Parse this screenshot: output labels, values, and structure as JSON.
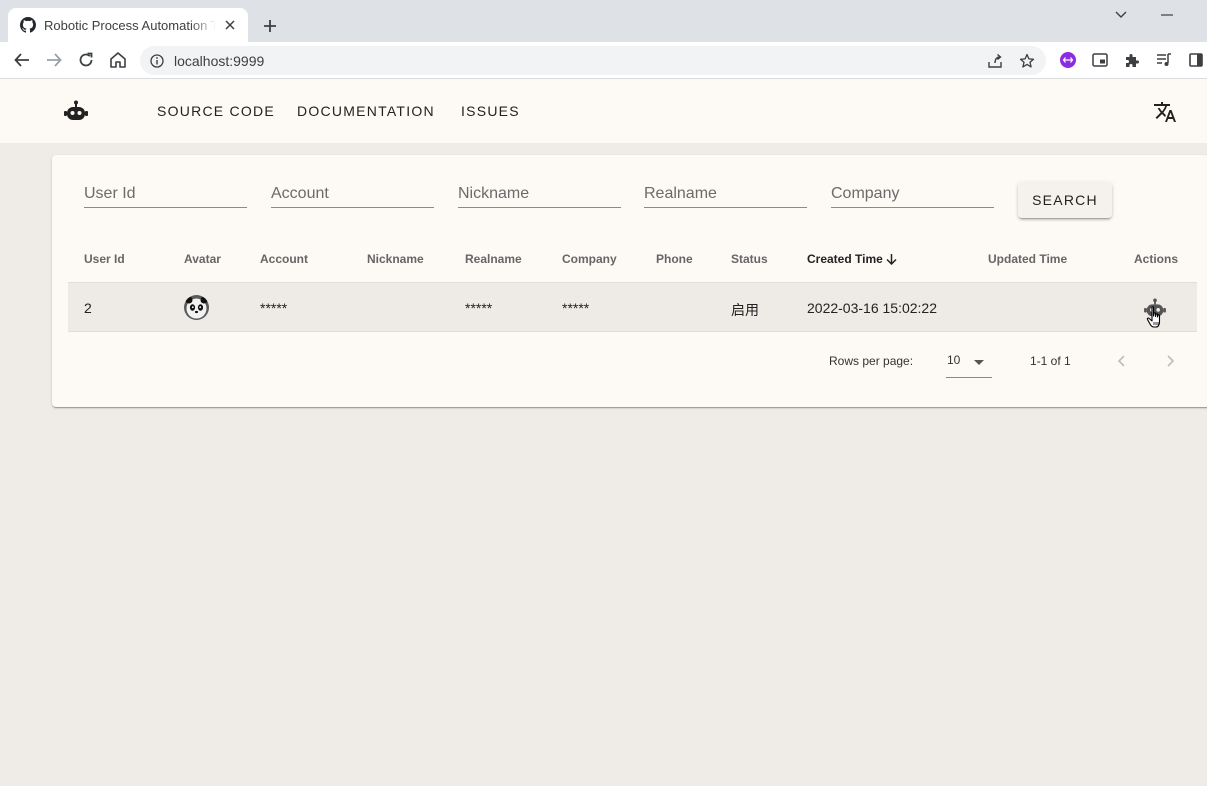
{
  "browser": {
    "tab_title": "Robotic Process Automation Tool",
    "url": "localhost:9999",
    "icons": [
      "github-icon",
      "close-icon",
      "plus-icon",
      "back-arrow-icon",
      "forward-arrow-icon",
      "reload-icon",
      "home-icon",
      "info-icon",
      "share-icon",
      "star-icon",
      "extension-icon",
      "picture-in-picture-icon",
      "puzzle-icon",
      "media-queue-icon",
      "side-panel-icon",
      "chevron-down-icon",
      "minimize-icon"
    ]
  },
  "appbar": {
    "nav": [
      "SOURCE CODE",
      "DOCUMENTATION",
      "ISSUES"
    ],
    "logo_icon": "robot-icon",
    "translate_icon": "translate-icon"
  },
  "filters": {
    "user_id": "User Id",
    "account": "Account",
    "nickname": "Nickname",
    "realname": "Realname",
    "company": "Company",
    "search_label": "SEARCH"
  },
  "table": {
    "headers": [
      "User Id",
      "Avatar",
      "Account",
      "Nickname",
      "Realname",
      "Company",
      "Phone",
      "Status",
      "Created Time",
      "Updated Time",
      "Actions"
    ],
    "sorted_column": "Created Time",
    "sort_direction": "descending",
    "rows": [
      {
        "user_id": "2",
        "avatar": "panda-avatar",
        "account": "*****",
        "nickname": "",
        "realname": "*****",
        "company": "*****",
        "phone": "",
        "status": "启用",
        "created_time": "2022-03-16 15:02:22",
        "updated_time": "",
        "action_icon": "robot-icon"
      }
    ]
  },
  "pagination": {
    "rows_per_page_label": "Rows per page:",
    "rows_per_page": "10",
    "range": "1-1 of 1"
  },
  "colors": {
    "page_bg": "#efece7",
    "card_bg": "#fdf9f5",
    "row_bg": "#eeeae5",
    "tabstrip": "#dee1e6",
    "extension_purple": "#8b2be2"
  }
}
